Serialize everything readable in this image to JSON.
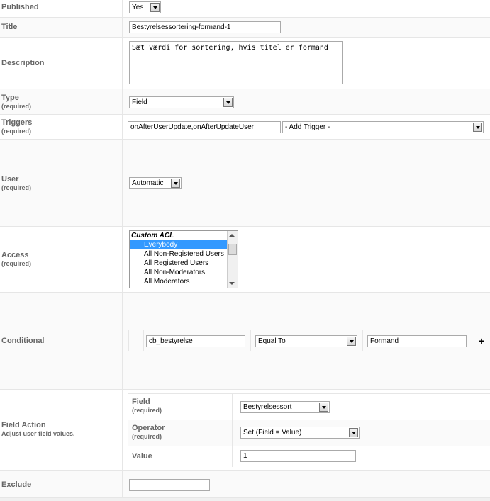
{
  "form": {
    "published": {
      "label": "Published",
      "value": "Yes"
    },
    "title": {
      "label": "Title",
      "value": "Bestyrelsessortering-formand-1"
    },
    "description": {
      "label": "Description",
      "value": "Sæt værdi for sortering, hvis titel er formand"
    },
    "type": {
      "label": "Type",
      "required": "(required)",
      "value": "Field"
    },
    "triggers": {
      "label": "Triggers",
      "required": "(required)",
      "value": "onAfterUserUpdate,onAfterUpdateUser",
      "add_trigger": "- Add Trigger -"
    },
    "user": {
      "label": "User",
      "required": "(required)",
      "value": "Automatic"
    },
    "access": {
      "label": "Access",
      "required": "(required)",
      "group": "Custom ACL",
      "options": [
        "Everybody",
        "All Non-Registered Users",
        "All Registered Users",
        "All Non-Moderators",
        "All Moderators"
      ],
      "selected": "Everybody"
    },
    "conditional": {
      "label": "Conditional",
      "field": "cb_bestyrelse",
      "operator": "Equal To",
      "value": "Formand",
      "add": "+"
    },
    "field_action": {
      "label": "Field Action",
      "description": "Adjust user field values.",
      "field_label": "Field",
      "field_required": "(required)",
      "field_value": "Bestyrelsessort",
      "operator_label": "Operator",
      "operator_required": "(required)",
      "operator_value": "Set (Field = Value)",
      "value_label": "Value",
      "value_value": "1"
    },
    "exclude": {
      "label": "Exclude",
      "value": ""
    }
  }
}
